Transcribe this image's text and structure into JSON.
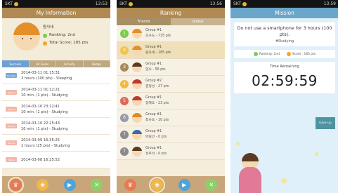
{
  "status": {
    "carrier": "SKT",
    "left_time": "13:53",
    "mid_time": "13:56",
    "right_time": "13:59"
  },
  "screen1": {
    "title": "My Information",
    "name": "왕사네",
    "ranking": "Ranking: 2nd",
    "total_score": "Total Score: 185 pts",
    "tabs": [
      "Success",
      "All Goals",
      "Activity",
      "Badge"
    ],
    "items": [
      {
        "tag": "Success",
        "date": "2014-03-11 01:15:31",
        "desc": "3 hours (100 pts) - Sleeping"
      },
      {
        "tag": "Failure",
        "date": "2014-03-11 01:12:21",
        "desc": "10 min. (1 pts) - Studying"
      },
      {
        "tag": "Failure",
        "date": "2014-03-10 23:12:41",
        "desc": "10 min. (1 pts) - Studying"
      },
      {
        "tag": "Failure",
        "date": "2014-03-10 22:25:43",
        "desc": "10 min. (1 pts) - Studying"
      },
      {
        "tag": "Failure",
        "date": "2014-03-09 16:35:25",
        "desc": "1 hours (25 pts) - Studying"
      },
      {
        "tag": "Failure",
        "date": "2014-03-08 16:25:52",
        "desc": ""
      }
    ]
  },
  "screen2": {
    "title": "Ranking",
    "tabs": [
      "Friends",
      "Global"
    ],
    "rows": [
      {
        "num": "1",
        "group": "Group #1",
        "detail": "조사도 - 735 pts",
        "color": "#7ccb52",
        "hair": "#e48f2a"
      },
      {
        "num": "2",
        "group": "Group #1",
        "detail": "왕사네 - 185 pts",
        "color": "#f5c54a",
        "hair": "#e48f2a"
      },
      {
        "num": "3",
        "group": "Group #1",
        "detail": "양사 - 56 pts",
        "color": "#a88a5a",
        "hair": "#5b3a22"
      },
      {
        "num": "4",
        "group": "Group #2",
        "detail": "권정성 - 27 pts",
        "color": "#f5b83a",
        "hair": "#c0392b"
      },
      {
        "num": "5",
        "group": "Group #1",
        "detail": "정해도 - 23 pts",
        "color": "#e0685a",
        "hair": "#c0392b"
      },
      {
        "num": "6",
        "group": "Group #1",
        "detail": "최사도 - 10 pts",
        "color": "#9a9aaa",
        "hair": "#d98a2a"
      },
      {
        "num": "7",
        "group": "Group #1",
        "detail": "박원인 - 0 pts",
        "color": "#8a8a8a",
        "hair": "#3a6ab0"
      },
      {
        "num": "7",
        "group": "Group #1",
        "detail": "성우석 - 0 pts",
        "color": "#8a8a8a",
        "hair": "#5b3a22"
      }
    ]
  },
  "screen3": {
    "title": "Mission",
    "message": "Do not use a smartphone for 3 hours (100 pts).",
    "hashtag": "#Studying",
    "ranking": "Ranking: 2nd",
    "score": "Score : 185 pts",
    "time_label": "Time Remaining",
    "clock": "02:59:59",
    "giveup": "Give up"
  }
}
